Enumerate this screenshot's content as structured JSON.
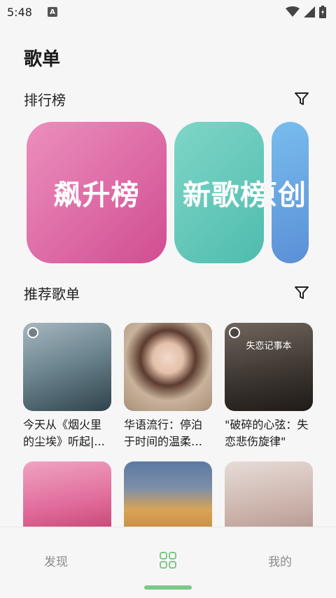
{
  "status_bar": {
    "time": "5:48",
    "notification_icon_letter": "A"
  },
  "page": {
    "title": "歌单"
  },
  "sections": {
    "charts": {
      "title": "排行榜"
    },
    "recommended": {
      "title": "推荐歌单"
    }
  },
  "charts": [
    {
      "label": "飙升榜",
      "gradient": [
        "#e0629f",
        "#ec8fbd"
      ]
    },
    {
      "label": "新歌榜",
      "gradient": [
        "#5fc7b8",
        "#7fd6c7"
      ]
    },
    {
      "label": "原创",
      "gradient": [
        "#6fb3ea",
        "#5b93d6"
      ]
    }
  ],
  "playlists": [
    {
      "title": "今天从《烟火里的尘埃》听起|...",
      "cover_colors": [
        "#8fa3ac",
        "#3f5560"
      ]
    },
    {
      "title": "华语流行：停泊于时间的温柔之...",
      "cover_colors": [
        "#d9c3ad",
        "#9c7f68"
      ]
    },
    {
      "title": "\"破碎的心弦：失恋悲伤旋律\"",
      "cover_overlay": "失恋记事本",
      "cover_colors": [
        "#5b5149",
        "#2b2622"
      ]
    },
    {
      "title": "",
      "cover_colors": [
        "#e77aa6",
        "#c43a6c"
      ]
    },
    {
      "title": "",
      "cover_colors": [
        "#5e7faa",
        "#d59a4a"
      ]
    },
    {
      "title": "",
      "cover_colors": [
        "#d8c7c0",
        "#b49a95"
      ]
    }
  ],
  "bottom_nav": [
    {
      "label": "发现"
    },
    {
      "label": "",
      "icon": "grid-icon"
    },
    {
      "label": "我的"
    }
  ],
  "colors": {
    "accent": "#7cc78a"
  }
}
